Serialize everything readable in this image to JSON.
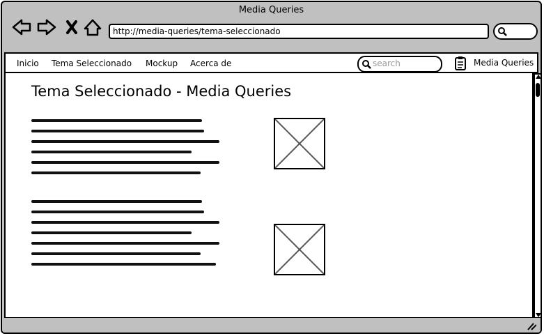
{
  "window": {
    "title": "Media Queries"
  },
  "browser": {
    "url": "http://media-queries/tema-seleccionado"
  },
  "menu": {
    "items": [
      {
        "label": "Inicio"
      },
      {
        "label": "Tema Seleccionado"
      },
      {
        "label": "Mockup"
      },
      {
        "label": "Acerca de"
      }
    ],
    "search_placeholder": "search",
    "brand": "Media Queries"
  },
  "page": {
    "title": "Tema Seleccionado -  Media Queries"
  },
  "icons": {
    "back": "back-arrow-icon",
    "forward": "forward-arrow-icon",
    "close": "close-icon",
    "home": "home-icon",
    "search": "search-icon",
    "clipboard": "clipboard-icon",
    "image": "image-placeholder-icon",
    "resize": "resize-grip-icon"
  }
}
